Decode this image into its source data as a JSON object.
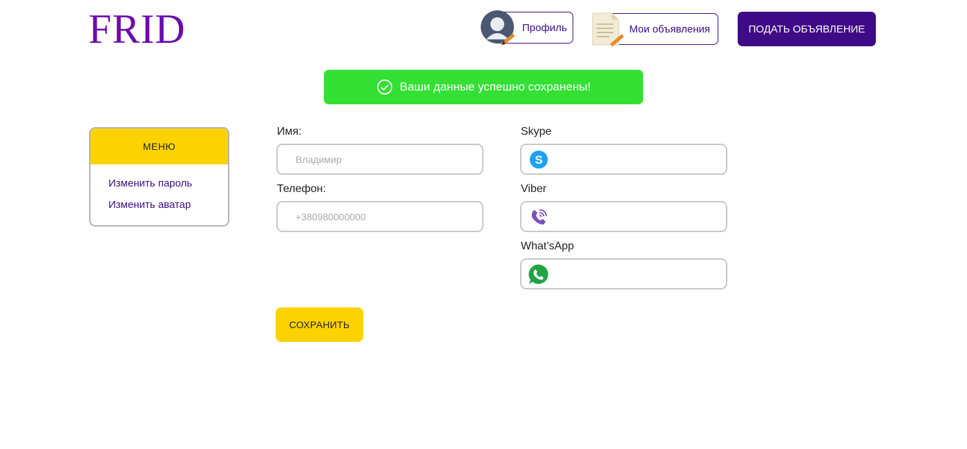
{
  "logo": "FRID",
  "header": {
    "profile_label": "Профиль",
    "my_ads_label": "Мои объявления",
    "post_ad_label": "ПОДАТЬ ОБЪЯВЛЕНИЕ"
  },
  "alert": {
    "message": "Ваши данные успешно сохранены!",
    "color": "#33e033"
  },
  "menu": {
    "title": "МЕНЮ",
    "items": [
      {
        "label": "Изменить пароль"
      },
      {
        "label": "Изменить аватар"
      }
    ]
  },
  "form": {
    "name": {
      "label": "Имя:",
      "placeholder": "Владимир"
    },
    "phone": {
      "label": "Телефон:",
      "placeholder": "+380980000000"
    },
    "skype": {
      "label": "Skype",
      "icon": "skype-icon",
      "value": ""
    },
    "viber": {
      "label": "Viber",
      "icon": "viber-icon",
      "value": ""
    },
    "whatsapp": {
      "label": "What’sApp",
      "icon": "whatsapp-icon",
      "value": ""
    },
    "save_label": "СОХРАНИТЬ"
  },
  "colors": {
    "brand": "#6a0dad",
    "primary": "#3f0a85",
    "accent": "#fcd300"
  }
}
